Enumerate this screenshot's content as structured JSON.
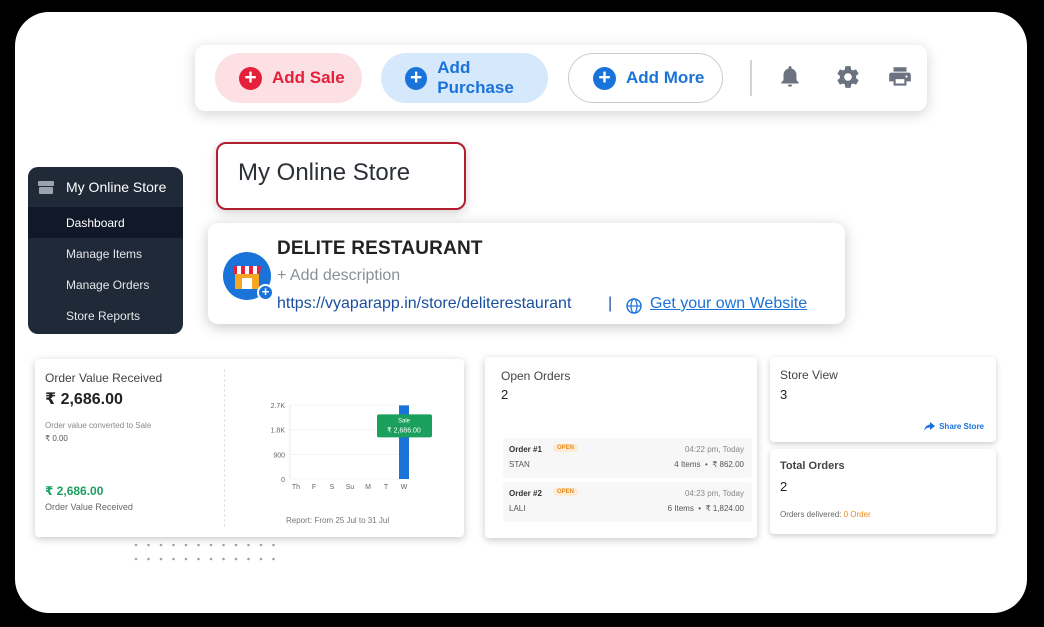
{
  "toolbar": {
    "add_sale": "Add Sale",
    "add_purchase": "Add Purchase",
    "add_more": "Add More",
    "icons": [
      "bell-icon",
      "gear-icon",
      "printer-icon"
    ]
  },
  "page_title": "My Online Store",
  "sidebar": {
    "header": "My Online Store",
    "items": [
      {
        "label": "Dashboard",
        "active": true
      },
      {
        "label": "Manage Items"
      },
      {
        "label": "Manage Orders"
      },
      {
        "label": "Store Reports"
      }
    ]
  },
  "store": {
    "name": "DELITE RESTAURANT",
    "add_description": "+ Add description",
    "url": "https://vyaparapp.in/store/deliterestaurant",
    "separator": "|",
    "own_website": "Get your own Website"
  },
  "order_value": {
    "title": "Order Value Received",
    "amount": "₹ 2,686.00",
    "converted_label": "Order value converted to Sale",
    "converted_value": "₹ 0.00",
    "received_amount": "₹ 2,686.00",
    "received_label": "Order Value Received",
    "report": "Report: From 25 Jul to 31 Jul"
  },
  "chart_data": {
    "type": "bar",
    "categories": [
      "Th",
      "F",
      "S",
      "Su",
      "M",
      "T",
      "W"
    ],
    "values": [
      0,
      0,
      0,
      0,
      0,
      0,
      2686
    ],
    "y_ticks": [
      "2.7K",
      "1.8K",
      "900",
      "0"
    ],
    "ylim": [
      0,
      2700
    ],
    "tooltip": {
      "label": "Sale",
      "value": "₹ 2,686.00"
    },
    "colors": {
      "bar": "#1a73d9",
      "tooltip": "#1b9f5c"
    }
  },
  "open_orders": {
    "title": "Open Orders",
    "count": "2",
    "orders": [
      {
        "num": "Order #1",
        "status": "OPEN",
        "time": "04:22 pm, Today",
        "name": "STAN",
        "items": "4 Items",
        "amount": "₹ 862.00"
      },
      {
        "num": "Order #2",
        "status": "OPEN",
        "time": "04:23 pm, Today",
        "name": "LALI",
        "items": "6 Items",
        "amount": "₹ 1,824.00"
      }
    ]
  },
  "store_view": {
    "title": "Store View",
    "count": "3",
    "share": "Share Store"
  },
  "total_orders": {
    "title": "Total Orders",
    "count": "2",
    "delivered_label": "Orders delivered:",
    "delivered_value": "0 Order"
  }
}
